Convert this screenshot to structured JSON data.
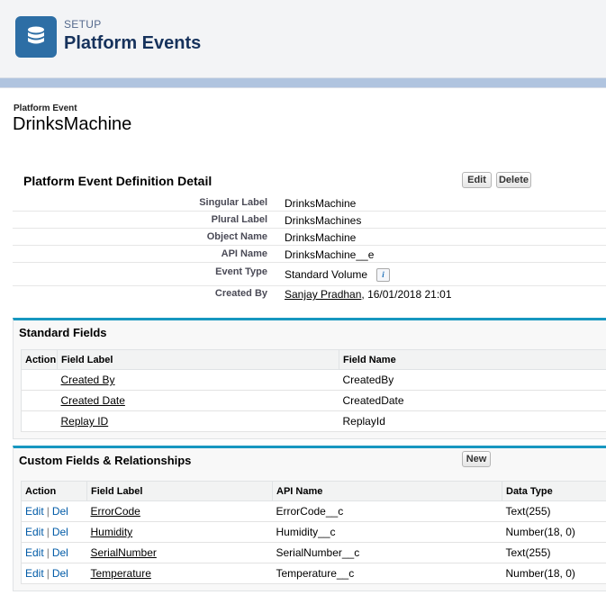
{
  "header": {
    "kicker": "SETUP",
    "title": "Platform Events",
    "icon": "database-icon",
    "icon_bg": "#2d6ea5"
  },
  "record": {
    "kicker": "Platform Event",
    "name": "DrinksMachine"
  },
  "detail": {
    "title": "Platform Event Definition Detail",
    "edit_label": "Edit",
    "delete_label": "Delete",
    "fields": [
      {
        "label": "Singular Label",
        "value": "DrinksMachine"
      },
      {
        "label": "Plural Label",
        "value": "DrinksMachines"
      },
      {
        "label": "Object Name",
        "value": "DrinksMachine"
      },
      {
        "label": "API Name",
        "value": "DrinksMachine__e"
      },
      {
        "label": "Event Type",
        "value": "Standard Volume"
      },
      {
        "label": "Created By",
        "user": "Sanjay Pradhan",
        "date": ", 16/01/2018 21:01"
      }
    ]
  },
  "standard_fields": {
    "title": "Standard Fields",
    "columns": [
      "Action",
      "Field Label",
      "Field Name"
    ],
    "rows": [
      {
        "label": "Created By",
        "name": "CreatedBy"
      },
      {
        "label": "Created Date",
        "name": "CreatedDate"
      },
      {
        "label": "Replay ID",
        "name": "ReplayId"
      }
    ]
  },
  "custom_fields": {
    "title": "Custom Fields & Relationships",
    "new_label": "New",
    "columns": [
      "Action",
      "Field Label",
      "API Name",
      "Data Type"
    ],
    "edit_label": "Edit",
    "sep": "|",
    "del_label": "Del",
    "rows": [
      {
        "label": "ErrorCode",
        "api": "ErrorCode__c",
        "type": "Text(255)"
      },
      {
        "label": "Humidity",
        "api": "Humidity__c",
        "type": "Number(18, 0)"
      },
      {
        "label": "SerialNumber",
        "api": "SerialNumber__c",
        "type": "Text(255)"
      },
      {
        "label": "Temperature",
        "api": "Temperature__c",
        "type": "Number(18, 0)"
      }
    ]
  },
  "colors": {
    "section_accent": "#1797c0",
    "link_blue": "#015ba7"
  }
}
